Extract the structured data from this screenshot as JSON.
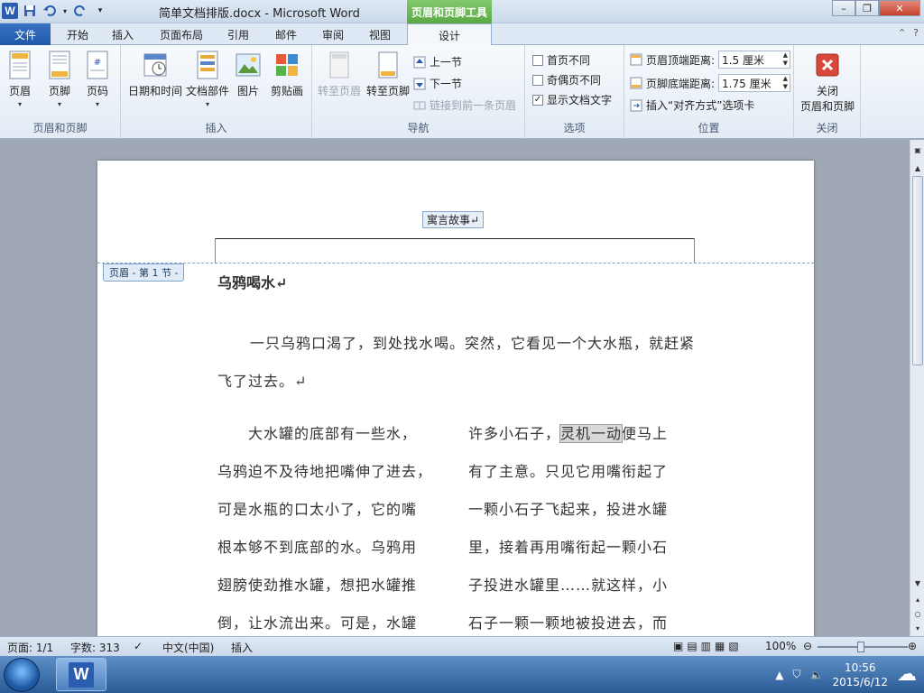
{
  "window": {
    "title": "简单文档排版.docx - Microsoft Word",
    "context_tab_title": "页眉和页脚工具",
    "controls": {
      "minimize": "–",
      "restore": "❐",
      "close": "✕"
    }
  },
  "tabs": [
    {
      "label": "文件"
    },
    {
      "label": "开始"
    },
    {
      "label": "插入"
    },
    {
      "label": "页面布局"
    },
    {
      "label": "引用"
    },
    {
      "label": "邮件"
    },
    {
      "label": "审阅"
    },
    {
      "label": "视图"
    },
    {
      "label": "设计"
    }
  ],
  "ribbon": {
    "groups": {
      "header_footer": {
        "label": "页眉和页脚",
        "buttons": [
          "页眉",
          "页脚",
          "页码"
        ]
      },
      "insert": {
        "label": "插入",
        "buttons": [
          "日期和时间",
          "文档部件",
          "图片",
          "剪贴画"
        ]
      },
      "navigation": {
        "label": "导航",
        "goto_header": "转至页眉",
        "goto_footer": "转至页脚",
        "prev_section": "上一节",
        "next_section": "下一节",
        "link_previous": "链接到前一条页眉"
      },
      "options": {
        "label": "选项",
        "first_page_diff": "首页不同",
        "odd_even_diff": "奇偶页不同",
        "show_doc_text": "显示文档文字",
        "first_page_checked": false,
        "odd_even_checked": false,
        "show_doc_text_checked": true
      },
      "position": {
        "label": "位置",
        "header_top_label": "页眉顶端距离:",
        "header_top_value": "1.5 厘米",
        "footer_bottom_label": "页脚底端距离:",
        "footer_bottom_value": "1.75 厘米",
        "insert_align_tab": "插入“对齐方式”选项卡"
      },
      "close": {
        "label": "关闭",
        "button_line1": "关闭",
        "button_line2": "页眉和页脚"
      }
    }
  },
  "document": {
    "header_text": "寓言故事↵",
    "header_tag": "页眉 - 第 1 节 -",
    "title": "乌鸦喝水↵",
    "para1": "一只乌鸦口渴了，到处找水喝。突然，它看见一个大水瓶，就赶紧飞了过去。↵",
    "left_col": [
      "　　大水罐的底部有一些水，",
      "乌鸦迫不及待地把嘴伸了进去，",
      "可是水瓶的口太小了，它的嘴",
      "根本够不到底部的水。乌鸦用",
      "翅膀使劲推水罐，想把水罐推",
      "倒，让水流出来。可是，水罐"
    ],
    "right_col": [
      {
        "pre": "许多小石子，",
        "hl": "灵机一动",
        "post": "便马上"
      },
      {
        "pre": "有了主意。只见它用嘴衔起了",
        "hl": "",
        "post": ""
      },
      {
        "pre": "一颗小石子飞起来，投进水罐",
        "hl": "",
        "post": ""
      },
      {
        "pre": "里，接着再用嘴衔起一颗小石",
        "hl": "",
        "post": ""
      },
      {
        "pre": "子投进水罐里……就这样，小",
        "hl": "",
        "post": ""
      },
      {
        "pre": "石子一颗一颗地被投进去，而",
        "hl": "",
        "post": ""
      }
    ]
  },
  "statusbar": {
    "page": "页面: 1/1",
    "words": "字数: 313",
    "language": "中文(中国)",
    "mode": "插入",
    "zoom": "100%"
  },
  "taskbar": {
    "time": "10:56",
    "date": "2015/6/12"
  },
  "colors": {
    "accent": "#2a5db0",
    "context_green": "#5aa943"
  }
}
